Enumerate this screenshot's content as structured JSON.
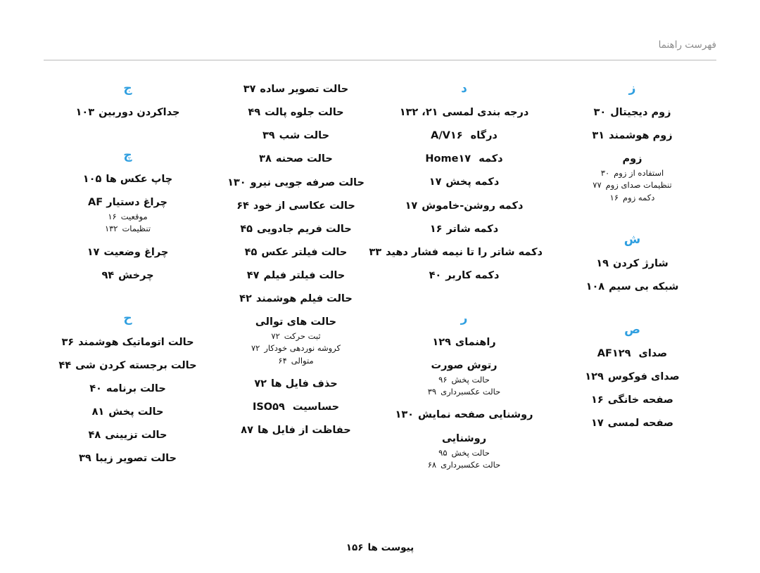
{
  "header": {
    "title": "فهرست راهنما"
  },
  "footer": {
    "label": "پیوست ها",
    "page": "۱۵۶"
  },
  "columns": [
    {
      "id": "column-zaa",
      "blocks": [
        {
          "letter": "ز",
          "entries": [
            {
              "label": "زوم دیجیتال",
              "page": "۳۰",
              "subentries": []
            },
            {
              "label": "زوم هوشمند",
              "page": "۳۱",
              "subentries": []
            },
            {
              "label": "زوم",
              "page": "",
              "subentries": [
                {
                  "label": "استفاده از زوم",
                  "page": "۳۰"
                },
                {
                  "label": "تنظیمات صدای زوم",
                  "page": "۷۷"
                },
                {
                  "label": "دکمه زوم",
                  "page": "۱۶"
                }
              ]
            }
          ]
        },
        {
          "letter": "ش",
          "entries": [
            {
              "label": "شارژ کردن",
              "page": "۱۹",
              "subentries": []
            },
            {
              "label": "شبکه بی سیم",
              "page": "۱۰۸",
              "subentries": []
            }
          ]
        },
        {
          "letter": "ص",
          "entries": [
            {
              "label": "صدای AF",
              "page": "۱۲۹",
              "subentries": []
            },
            {
              "label": "صدای فوکوس",
              "page": "۱۲۹",
              "subentries": []
            },
            {
              "label": "صفحه خانگی",
              "page": "۱۶",
              "subentries": []
            },
            {
              "label": "صفحه لمسی",
              "page": "۱۷",
              "subentries": []
            }
          ]
        }
      ]
    },
    {
      "id": "column-daal",
      "blocks": [
        {
          "letter": "د",
          "entries": [
            {
              "label": "درجه بندی لمسی",
              "page": "۲۱، ۱۳۲",
              "subentries": []
            },
            {
              "label": "درگاه A/V",
              "page": "۱۶",
              "subentries": []
            },
            {
              "label": "دکمه Home",
              "page": "۱۷",
              "subentries": []
            },
            {
              "label": "دکمه پخش",
              "page": "۱۷",
              "subentries": []
            },
            {
              "label": "دکمه روشن-خاموش",
              "page": "۱۷",
              "subentries": []
            },
            {
              "label": "دکمه شاتر",
              "page": "۱۶",
              "subentries": []
            },
            {
              "label": "دکمه شاتر را تا نیمه فشار دهید",
              "page": "۳۳",
              "subentries": []
            },
            {
              "label": "دکمه کاربر",
              "page": "۴۰",
              "subentries": []
            }
          ]
        },
        {
          "letter": "ر",
          "entries": [
            {
              "label": "راهنمای",
              "page": "۱۲۹",
              "subentries": []
            },
            {
              "label": "رتوش صورت",
              "page": "",
              "subentries": [
                {
                  "label": "حالت پخش",
                  "page": "۹۶"
                },
                {
                  "label": "حالت عکسبرداری",
                  "page": "۳۹"
                }
              ]
            },
            {
              "label": "روشنایی صفحه نمایش",
              "page": "۱۳۰",
              "subentries": []
            },
            {
              "label": "روشنایی",
              "page": "",
              "subentries": [
                {
                  "label": "حالت پخش",
                  "page": "۹۵"
                },
                {
                  "label": "حالت عکسبرداری",
                  "page": "۶۸"
                }
              ]
            }
          ]
        }
      ]
    },
    {
      "id": "column-haa-continued",
      "blocks": [
        {
          "letter": "",
          "entries": [
            {
              "label": "حالت تصویر ساده",
              "page": "۳۷",
              "subentries": []
            },
            {
              "label": "حالت جلوه پالت",
              "page": "۴۹",
              "subentries": []
            },
            {
              "label": "حالت شب",
              "page": "۳۹",
              "subentries": []
            },
            {
              "label": "حالت صحنه",
              "page": "۳۸",
              "subentries": []
            },
            {
              "label": "حالت صرفه جویی نیرو",
              "page": "۱۳۰",
              "subentries": []
            },
            {
              "label": "حالت عکاسی از خود",
              "page": "۶۴",
              "subentries": []
            },
            {
              "label": "حالت فریم جادویی",
              "page": "۴۵",
              "subentries": []
            },
            {
              "label": "حالت فیلتر عکس",
              "page": "۴۵",
              "subentries": []
            },
            {
              "label": "حالت فیلتر فیلم",
              "page": "۴۷",
              "subentries": []
            },
            {
              "label": "حالت فیلم هوشمند",
              "page": "۴۲",
              "subentries": []
            },
            {
              "label": "حالت های توالی",
              "page": "",
              "subentries": [
                {
                  "label": "ثبت حرکت",
                  "page": "۷۲"
                },
                {
                  "label": "کروشه نوردهی خودکار",
                  "page": "۷۲"
                },
                {
                  "label": "متوالی",
                  "page": "۶۴"
                }
              ]
            },
            {
              "label": "حذف فایل ها",
              "page": "۷۲",
              "subentries": []
            },
            {
              "label": "حساسیت ISO",
              "page": "۵۹",
              "subentries": []
            },
            {
              "label": "حفاظت از فایل ها",
              "page": "۸۷",
              "subentries": []
            }
          ]
        }
      ]
    },
    {
      "id": "column-jeem",
      "blocks": [
        {
          "letter": "ج",
          "entries": [
            {
              "label": "جداکردن دوربین",
              "page": "۱۰۳",
              "subentries": []
            }
          ]
        },
        {
          "letter": "چ",
          "entries": [
            {
              "label": "چاپ عکس ها",
              "page": "۱۰۵",
              "subentries": []
            },
            {
              "label": "چراغ دستیار AF",
              "page": "",
              "subentries": [
                {
                  "label": "موقعیت",
                  "page": "۱۶"
                },
                {
                  "label": "تنظیمات",
                  "page": "۱۳۲"
                }
              ]
            },
            {
              "label": "چراغ وضعیت",
              "page": "۱۷",
              "subentries": []
            },
            {
              "label": "چرخش",
              "page": "۹۴",
              "subentries": []
            }
          ]
        },
        {
          "letter": "ح",
          "entries": [
            {
              "label": "حالت اتوماتیک هوشمند",
              "page": "۳۶",
              "subentries": []
            },
            {
              "label": "حالت برجسته کردن شی",
              "page": "۴۴",
              "subentries": []
            },
            {
              "label": "حالت برنامه",
              "page": "۴۰",
              "subentries": []
            },
            {
              "label": "حالت پخش",
              "page": "۸۱",
              "subentries": []
            },
            {
              "label": "حالت تزیینی",
              "page": "۴۸",
              "subentries": []
            },
            {
              "label": "حالت تصویر زیبا",
              "page": "۳۹",
              "subentries": []
            }
          ]
        }
      ]
    }
  ]
}
